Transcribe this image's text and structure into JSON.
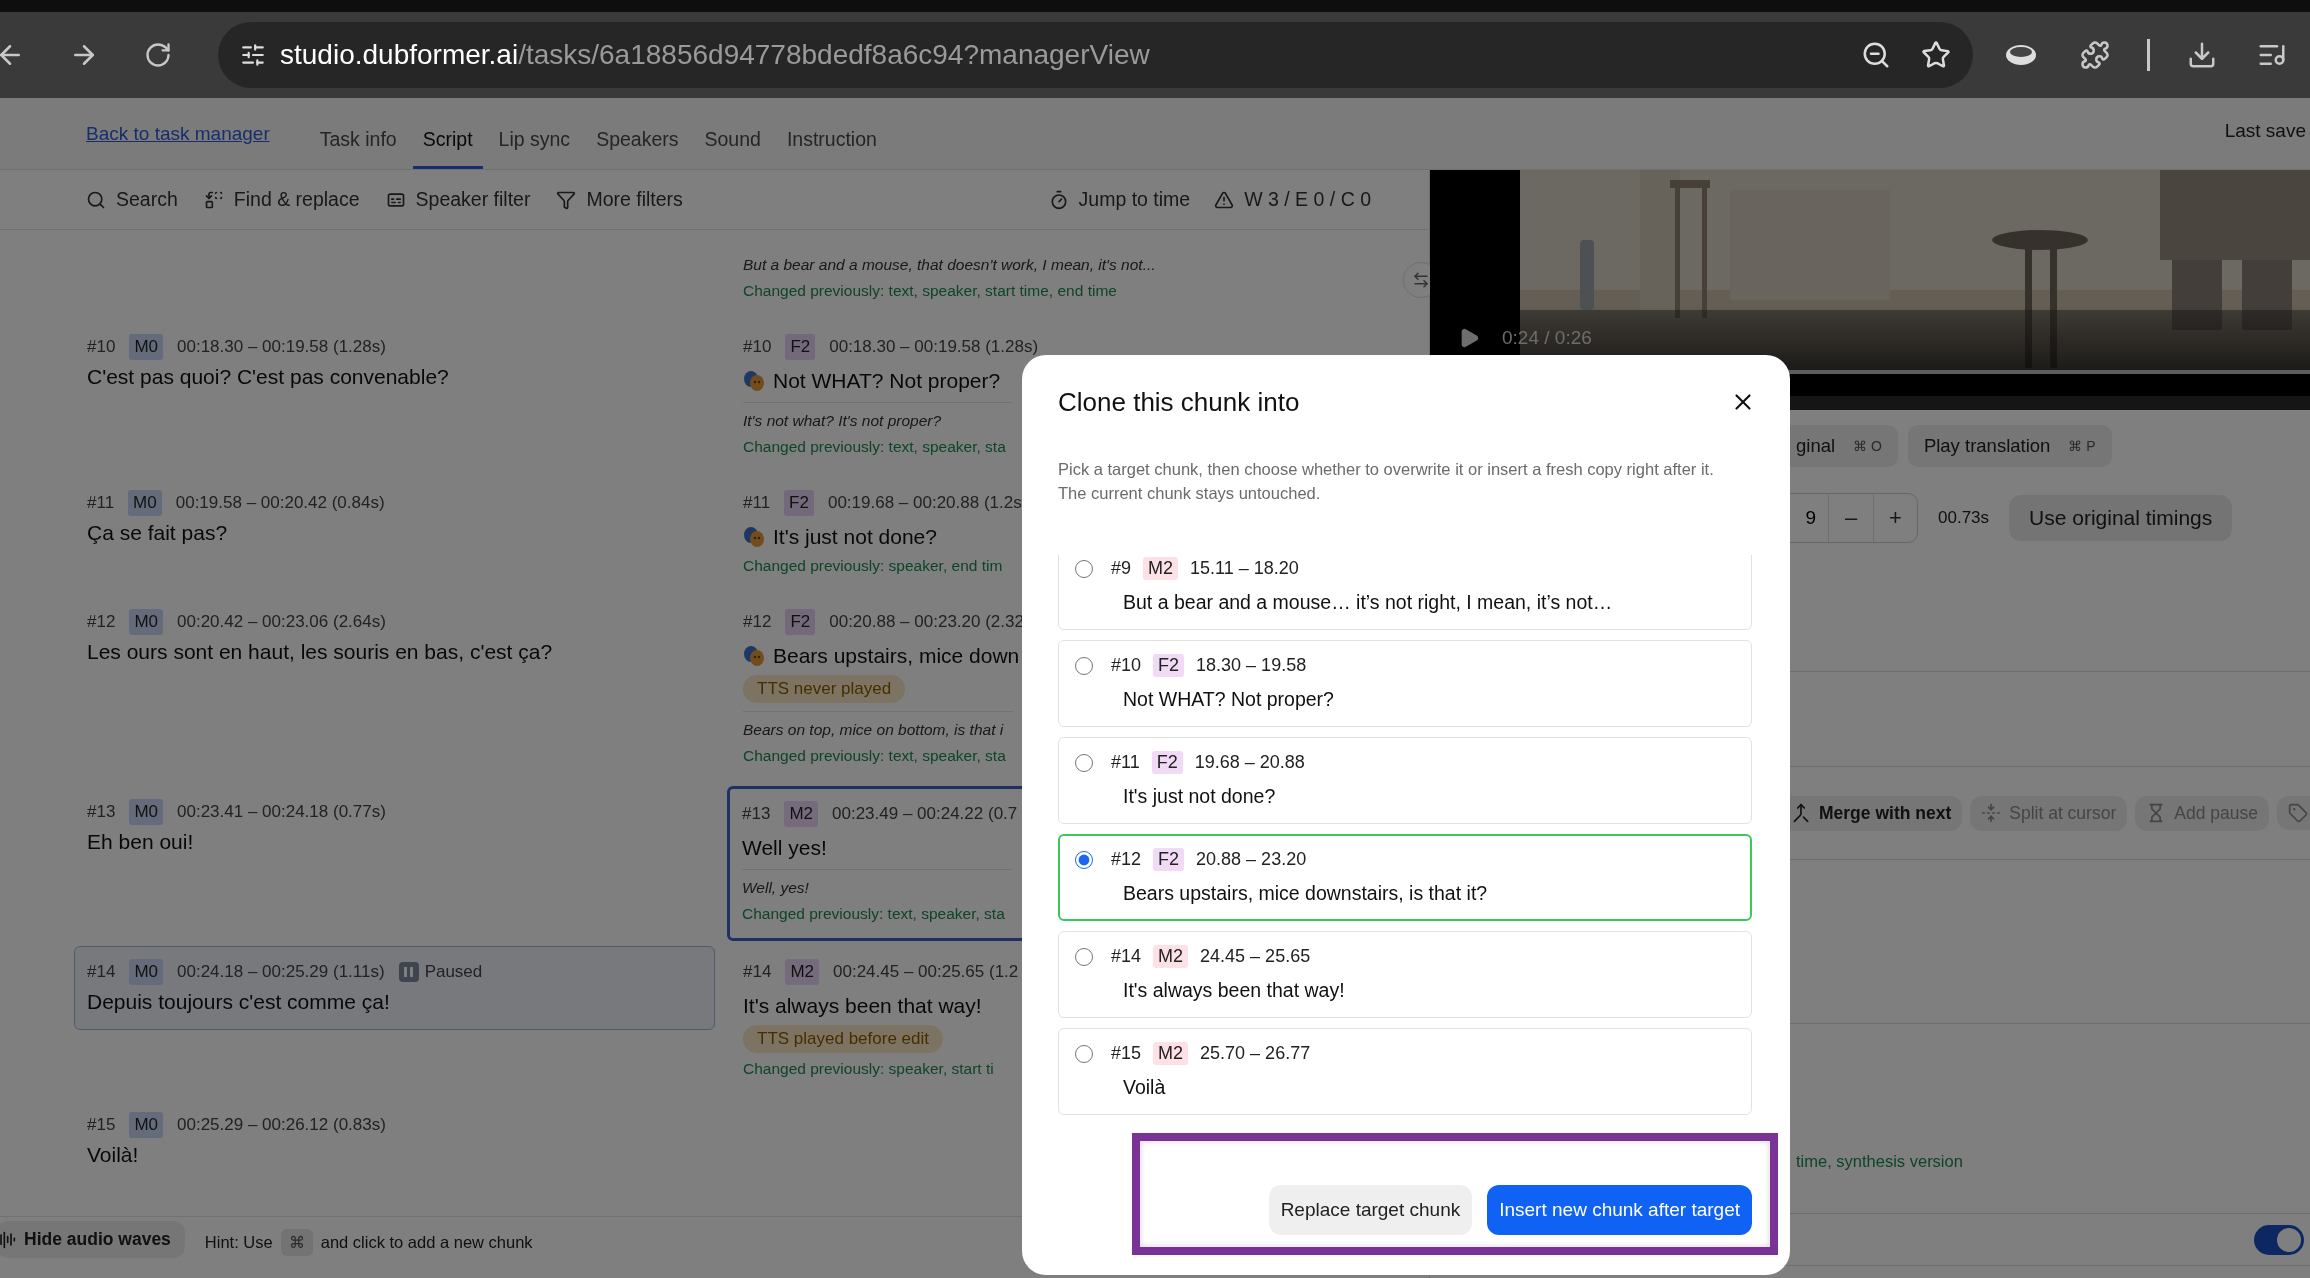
{
  "browser": {
    "url": {
      "host": "studio.dubformer.ai",
      "path": "/tasks/6a18856d94778bdedf8a6c94?managerView"
    }
  },
  "nav": {
    "back_link": "Back to task manager",
    "last_save": "Last save",
    "tabs": [
      {
        "label": "Task info",
        "selected": false
      },
      {
        "label": "Script",
        "selected": true
      },
      {
        "label": "Lip sync",
        "selected": false
      },
      {
        "label": "Speakers",
        "selected": false
      },
      {
        "label": "Sound",
        "selected": false
      },
      {
        "label": "Instruction",
        "selected": false
      }
    ]
  },
  "toolbar": {
    "left": [
      {
        "kind": "search",
        "label": "Search"
      },
      {
        "kind": "replace",
        "label": "Find & replace"
      },
      {
        "kind": "speaker",
        "label": "Speaker filter"
      },
      {
        "kind": "filter",
        "label": "More filters"
      }
    ],
    "right": [
      {
        "kind": "timer",
        "label": "Jump to time"
      },
      {
        "kind": "warning",
        "label": "W 3 / E 0 / C 0"
      }
    ]
  },
  "script": {
    "rows": [
      {
        "translation": {
          "note": "But a bear and a mouse, that doesn't work, I mean, it's not...",
          "changed": "Changed previously: text, speaker, start time, end time"
        }
      },
      {
        "original": {
          "number": "#10",
          "speaker": "M0",
          "color": "#646c7c",
          "time": "00:18.30 – 00:19.58 (1.28s)",
          "text": "C'est pas quoi? C'est pas convenable?"
        },
        "translation": {
          "number": "#10",
          "speaker": "F2",
          "color": "#73697b",
          "time": "00:18.30 – 00:19.58 (1.28s)",
          "masks": true,
          "text": "Not WHAT? Not proper?",
          "note": "It's not what? It's not proper?",
          "changed": "Changed previously: text, speaker, sta"
        }
      },
      {
        "original": {
          "number": "#11",
          "speaker": "M0",
          "color": "#646c7c",
          "time": "00:19.58 – 00:20.42 (0.84s)",
          "text": "Ça se fait pas?"
        },
        "translation": {
          "number": "#11",
          "speaker": "F2",
          "color": "#73697b",
          "time": "00:19.68 – 00:20.88 (1.2s",
          "masks": true,
          "text": "It's just not done?",
          "changed": "Changed previously: speaker, end tim"
        }
      },
      {
        "original": {
          "number": "#12",
          "speaker": "M0",
          "color": "#646c7c",
          "time": "00:20.42 – 00:23.06 (2.64s)",
          "text": "Les ours sont en haut, les souris en bas, c'est ça?"
        },
        "translation": {
          "number": "#12",
          "speaker": "F2",
          "color": "#73697b",
          "time": "00:20.88 – 00:23.20 (2.32",
          "masks": true,
          "text": "Bears upstairs, mice down",
          "badge": "TTS never played",
          "note": "Bears on top, mice on bottom, is that i",
          "changed": "Changed previously: text, speaker, sta"
        }
      },
      {
        "original": {
          "number": "#13",
          "speaker": "M0",
          "color": "#646c7c",
          "time": "00:23.41 – 00:24.18 (0.77s)",
          "text": "Eh ben oui!"
        },
        "translation": {
          "number": "#13",
          "speaker": "M2",
          "color": "#766b7c",
          "time": "00:23.49 – 00:24.22 (0.7",
          "text": "Well yes!",
          "note": "Well, yes!",
          "changed": "Changed previously: text, speaker, sta",
          "selected": true
        }
      },
      {
        "original": {
          "number": "#14",
          "speaker": "M0",
          "color": "#646c7c",
          "time": "00:24.18 – 00:25.29 (1.11s)",
          "status": "Paused",
          "text": "Depuis toujours c'est comme ça!",
          "active": true
        },
        "translation": {
          "number": "#14",
          "speaker": "M2",
          "color": "#766b7c",
          "time": "00:24.45 – 00:25.65 (1.2",
          "text": "It's always been that way!",
          "badge": "TTS played before edit",
          "changed": "Changed previously: speaker, start ti"
        }
      },
      {
        "original": {
          "number": "#15",
          "speaker": "M0",
          "color": "#646c7c",
          "time": "00:25.29 – 00:26.12 (0.83s)",
          "text": "Voilà!"
        }
      }
    ]
  },
  "bottom_bar": {
    "waves_button": "Hide audio waves",
    "hint_start": "Hint: Use",
    "key": "⌘",
    "hint_end": "and click to add a new chunk"
  },
  "player": {
    "time": "0:24 / 0:26"
  },
  "playback": [
    {
      "label": "ginal",
      "shortcut": "⌘ O"
    },
    {
      "label": "Play translation",
      "shortcut": "⌘ P"
    }
  ],
  "timing": {
    "value": "9",
    "minus": "–",
    "plus": "+",
    "duration": "00.73s",
    "reset": "Use original timings"
  },
  "actions": [
    {
      "kind": "merge",
      "label": "Merge with next",
      "disabled": false
    },
    {
      "kind": "split",
      "label": "Split at cursor",
      "disabled": true
    },
    {
      "kind": "pause",
      "label": "Add pause",
      "disabled": true
    },
    {
      "kind": "tag",
      "disabled": true
    }
  ],
  "changed_note": "time, synthesis version",
  "toggle": {
    "on": true
  },
  "dialog": {
    "title": "Clone this chunk into",
    "description": "Pick a target chunk, then choose whether to overwrite it or insert a fresh copy right after it. The current chunk stays untouched.",
    "highlighted": true,
    "options": [
      {
        "number": "#9",
        "speaker": "M2",
        "color": "#fde1e7",
        "range": "15.11 – 18.20",
        "text": "But a bear and a mouse… it’s not right, I mean, it’s not…",
        "selected": false
      },
      {
        "number": "#10",
        "speaker": "F2",
        "color": "#f1daf5",
        "range": "18.30 – 19.58",
        "text": "Not WHAT? Not proper?",
        "selected": false
      },
      {
        "number": "#11",
        "speaker": "F2",
        "color": "#f1daf5",
        "range": "19.68 – 20.88",
        "text": "It's just not done?",
        "selected": false
      },
      {
        "number": "#12",
        "speaker": "F2",
        "color": "#f1daf5",
        "range": "20.88 – 23.20",
        "text": "Bears upstairs, mice downstairs, is that it?",
        "selected": true
      },
      {
        "number": "#14",
        "speaker": "M2",
        "color": "#fde1e7",
        "range": "24.45 – 25.65",
        "text": "It's always been that way!",
        "selected": false
      },
      {
        "number": "#15",
        "speaker": "M2",
        "color": "#fde1e7",
        "range": "25.70 – 26.77",
        "text": "Voilà",
        "selected": false
      }
    ],
    "buttons": [
      {
        "kind": "secondary",
        "label": "Replace target chunk"
      },
      {
        "kind": "primary",
        "label": "Insert new chunk after target"
      }
    ]
  }
}
